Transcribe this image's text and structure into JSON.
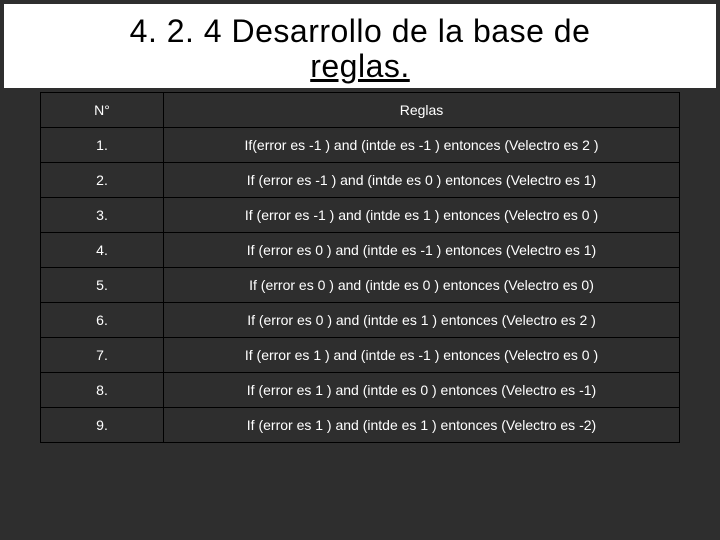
{
  "title": {
    "line1": "4. 2. 4 Desarrollo de la base de",
    "line2": "reglas."
  },
  "table": {
    "headers": [
      "N°",
      "Reglas"
    ],
    "rows": [
      {
        "n": "1.",
        "rule": "If(error es -1 ) and (intde es -1 ) entonces  (Velectro es 2 )"
      },
      {
        "n": "2.",
        "rule": "If (error es -1 ) and (intde es  0 ) entonces  (Velectro es 1)"
      },
      {
        "n": "3.",
        "rule": "If (error es -1 ) and (intde es 1 ) entonces  (Velectro es 0 )"
      },
      {
        "n": "4.",
        "rule": "If (error es 0 ) and (intde es -1 ) entonces  (Velectro es 1)"
      },
      {
        "n": "5.",
        "rule": "If (error es 0 ) and (intde es 0 ) entonces  (Velectro es 0)"
      },
      {
        "n": "6.",
        "rule": "If (error es 0 ) and (intde es 1 ) entonces  (Velectro es 2 )"
      },
      {
        "n": "7.",
        "rule": "If (error es 1 ) and (intde es -1 ) entonces  (Velectro es 0 )"
      },
      {
        "n": "8.",
        "rule": "If (error es 1 ) and (intde es 0 ) entonces  (Velectro es -1)"
      },
      {
        "n": "9.",
        "rule": "If (error es 1 ) and (intde es 1 ) entonces  (Velectro es -2)"
      }
    ]
  }
}
